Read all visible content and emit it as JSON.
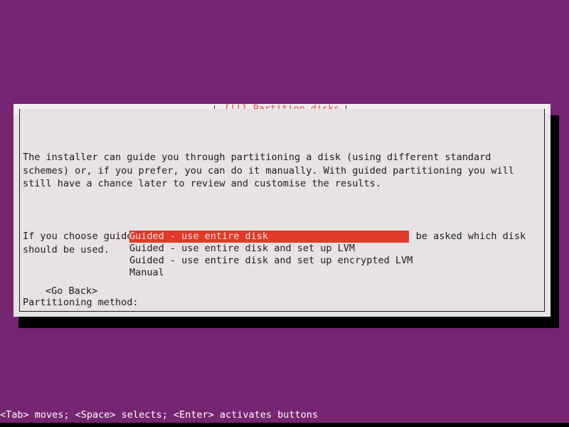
{
  "screen": {
    "background_color": "#762572",
    "shadow_color": "#000000"
  },
  "dialog": {
    "title": "[!!] Partition disks",
    "title_color": "#e04a3c",
    "background_color": "#e7e3e5",
    "border_color": "#1b1b1b",
    "paragraphs": [
      "The installer can guide you through partitioning a disk (using different standard\nschemes) or, if you prefer, you can do it manually. With guided partitioning you will\nstill have a chance later to review and customise the results.",
      "If you choose guided partitioning for an entire disk, you will next be asked which disk\nshould be used."
    ],
    "method_label": "Partitioning method:",
    "options": [
      {
        "label": "Guided - use entire disk",
        "selected": true
      },
      {
        "label": "Guided - use entire disk and set up LVM",
        "selected": false
      },
      {
        "label": "Guided - use entire disk and set up encrypted LVM",
        "selected": false
      },
      {
        "label": "Manual",
        "selected": false
      }
    ],
    "selected_option_index": 0,
    "highlight_color": "#e03a28",
    "highlight_text_color": "#eae3e6",
    "go_back_label": "<Go Back>"
  },
  "status_bar": {
    "text": "<Tab> moves; <Space> selects; <Enter> activates buttons",
    "text_color": "#ffffff"
  }
}
